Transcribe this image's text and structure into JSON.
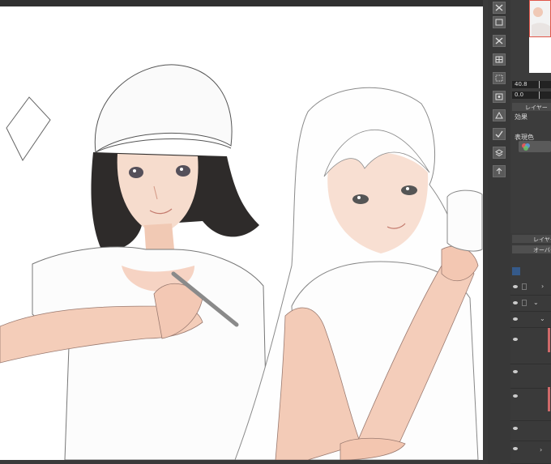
{
  "tool_panel": {
    "opacity_value": "40.8",
    "brush_value": "0.0",
    "layer_prop_tab_label": "レイヤー",
    "effect_label": "効果",
    "expression_color_label": "表現色"
  },
  "layer_panel": {
    "tab_label": "レイヤー",
    "blend_mode": "オーバー"
  },
  "colors": {
    "canvas": "#ffffff",
    "ui_dark": "#3c3c3c",
    "navigator_border": "#e0564a",
    "layer_highlight": "#d06a6a"
  }
}
